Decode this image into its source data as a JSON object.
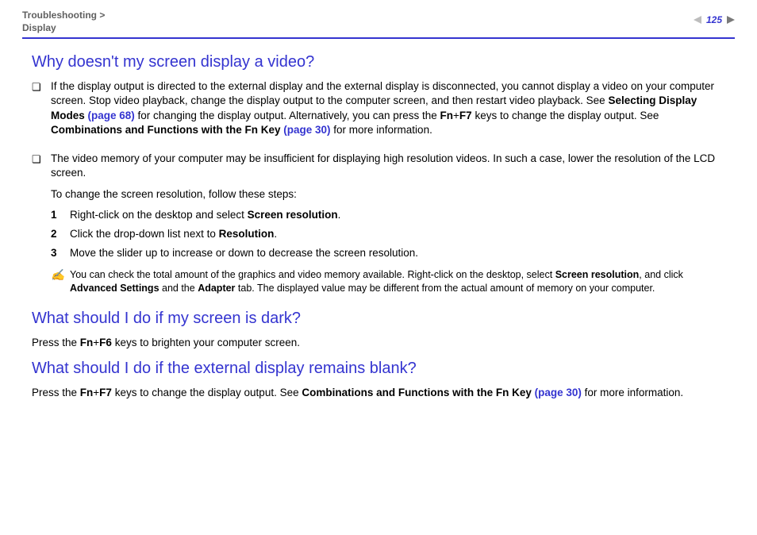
{
  "header": {
    "breadcrumb_section": "Troubleshooting",
    "breadcrumb_sep": " > ",
    "breadcrumb_sub": "Display",
    "page_number": "125"
  },
  "s1": {
    "heading": "Why doesn't my screen display a video?",
    "b1_pre": "If the display output is directed to the external display and the external display is disconnected, you cannot display a video on your computer screen. Stop video playback, change the display output to the computer screen, and then restart video playback. See ",
    "b1_link1_text": "Selecting Display Modes",
    "b1_link1_page": " (page 68)",
    "b1_mid": " for changing the display output. Alternatively, you can press the ",
    "b1_key1": "Fn",
    "b1_plus": "+",
    "b1_key2": "F7",
    "b1_mid2": " keys to change the display output. See ",
    "b1_link2_text": "Combinations and Functions with the Fn Key",
    "b1_link2_page": " (page 30)",
    "b1_end": " for more information.",
    "b2_p1": "The video memory of your computer may be insufficient for displaying high resolution videos. In such a case, lower the resolution of the LCD screen.",
    "b2_p2": "To change the screen resolution, follow these steps:",
    "step1_pre": "Right-click on the desktop and select ",
    "step1_bold": "Screen resolution",
    "step1_end": ".",
    "step2_pre": "Click the drop-down list next to ",
    "step2_bold": "Resolution",
    "step2_end": ".",
    "step3": "Move the slider up to increase or down to decrease the screen resolution.",
    "note_icon": "✍",
    "note_pre": "You can check the total amount of the graphics and video memory available. Right-click on the desktop, select ",
    "note_b1": "Screen resolution",
    "note_mid1": ", and click ",
    "note_b2": "Advanced Settings",
    "note_mid2": " and the ",
    "note_b3": "Adapter",
    "note_end": " tab. The displayed value may be different from the actual amount of memory on your computer."
  },
  "s2": {
    "heading": "What should I do if my screen is dark?",
    "p_pre": "Press the ",
    "key1": "Fn",
    "plus": "+",
    "key2": "F6",
    "p_end": " keys to brighten your computer screen."
  },
  "s3": {
    "heading": "What should I do if the external display remains blank?",
    "p_pre": "Press the ",
    "key1": "Fn",
    "plus": "+",
    "key2": "F7",
    "p_mid": " keys to change the display output. See ",
    "link_text": "Combinations and Functions with the Fn Key",
    "link_page": " (page 30)",
    "p_end": " for more information."
  },
  "nums": {
    "n1": "1",
    "n2": "2",
    "n3": "3"
  },
  "marks": {
    "square": "❏"
  }
}
